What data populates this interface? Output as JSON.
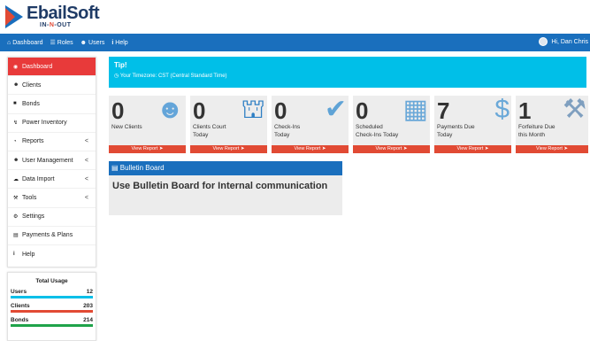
{
  "brand": {
    "name": "EbailSoft",
    "sub_prefix": "IN-",
    "sub_n": "N",
    "sub_suffix": "-OUT",
    "primary_color": "#1a6fbd",
    "accent_color": "#e14a34"
  },
  "topnav": {
    "items": [
      {
        "icon": "home-icon",
        "label": "Dashboard"
      },
      {
        "icon": "list-icon",
        "label": "Roles"
      },
      {
        "icon": "users-icon",
        "label": "Users"
      },
      {
        "icon": "info-icon",
        "label": "Help"
      }
    ],
    "user_greeting": "Hi, Dan Chris"
  },
  "sidebar": {
    "items": [
      {
        "icon": "dashboard-icon",
        "label": "Dashboard",
        "active": true,
        "has_submenu": false
      },
      {
        "icon": "users-icon",
        "label": "Clients",
        "active": false,
        "has_submenu": false
      },
      {
        "icon": "folder-icon",
        "label": "Bonds",
        "active": false,
        "has_submenu": false
      },
      {
        "icon": "bolt-icon",
        "label": "Power Inventory",
        "active": false,
        "has_submenu": false
      },
      {
        "icon": "pie-chart-icon",
        "label": "Reports",
        "active": false,
        "has_submenu": true
      },
      {
        "icon": "user-group-icon",
        "label": "User Management",
        "active": false,
        "has_submenu": true
      },
      {
        "icon": "cloud-upload-icon",
        "label": "Data Import",
        "active": false,
        "has_submenu": true
      },
      {
        "icon": "wrench-icon",
        "label": "Tools",
        "active": false,
        "has_submenu": true
      },
      {
        "icon": "gear-icon",
        "label": "Settings",
        "active": false,
        "has_submenu": false
      },
      {
        "icon": "credit-card-icon",
        "label": "Payments & Plans",
        "active": false,
        "has_submenu": false
      },
      {
        "icon": "info-icon",
        "label": "Help",
        "active": false,
        "has_submenu": false
      }
    ],
    "chevron": "<"
  },
  "usage": {
    "title": "Total Usage",
    "rows": [
      {
        "label": "Users",
        "value": "12",
        "color": "#00bfe8"
      },
      {
        "label": "Clients",
        "value": "203",
        "color": "#e14a34"
      },
      {
        "label": "Bonds",
        "value": "214",
        "color": "#1fa34a"
      }
    ]
  },
  "tip": {
    "title": "Tip!",
    "body": "Your Timezone: CST (Central Standard Time)"
  },
  "tiles": [
    {
      "value": "0",
      "label_line1": "New Clients",
      "label_line2": "",
      "icon": "users-group-icon",
      "icon_color": "#64a5d9",
      "button": "View Report"
    },
    {
      "value": "0",
      "label_line1": "Clients Court",
      "label_line2": "Today",
      "icon": "courthouse-icon",
      "icon_color": "#2e7fc4",
      "button": "View Report"
    },
    {
      "value": "0",
      "label_line1": "Check-Ins",
      "label_line2": "Today",
      "icon": "check-circle-icon",
      "icon_color": "#5fa3d6",
      "button": "View Report"
    },
    {
      "value": "0",
      "label_line1": "Scheduled",
      "label_line2": "Check-Ins Today",
      "icon": "calendar-icon",
      "icon_color": "#6aa8d8",
      "button": "View Report"
    },
    {
      "value": "7",
      "label_line1": "Payments Due",
      "label_line2": "Today",
      "icon": "dollar-icon",
      "icon_color": "#6aa8d8",
      "button": "View Report"
    },
    {
      "value": "1",
      "label_line1": "Forfeiture Due",
      "label_line2": "this Month",
      "icon": "gavel-icon",
      "icon_color": "#7f9fbf",
      "button": "View Report"
    }
  ],
  "bulletin": {
    "header": "Bulletin Board",
    "body": "Use Bulletin Board for Internal communication"
  }
}
